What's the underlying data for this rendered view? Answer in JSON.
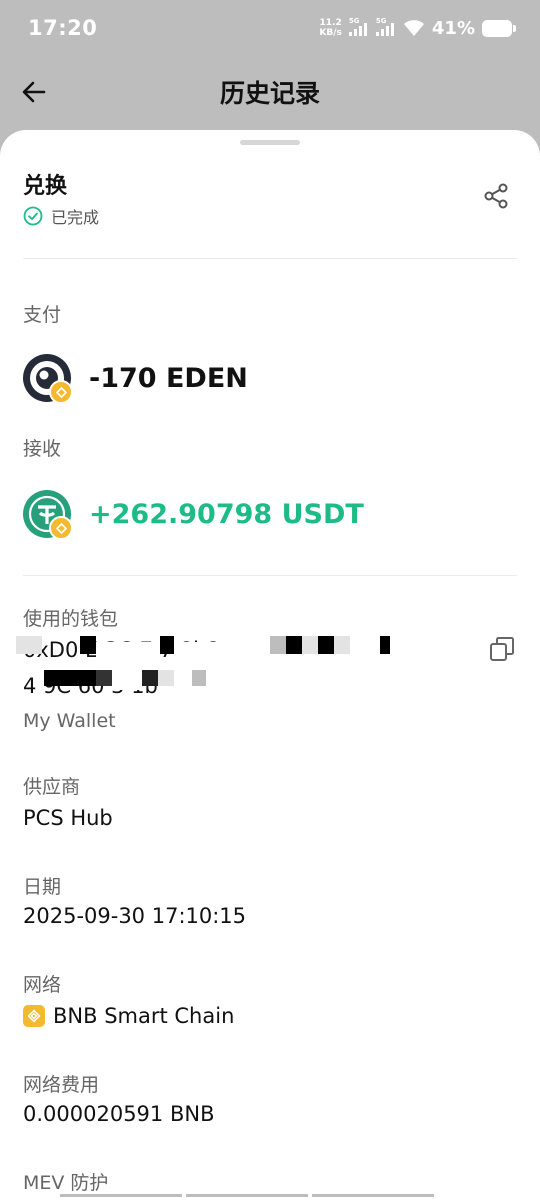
{
  "status_bar": {
    "time": "17:20",
    "net_speed_value": "11.2",
    "net_speed_unit": "KB/s",
    "sim1": "5G",
    "sim2": "5G",
    "battery": "41%"
  },
  "header": {
    "title": "历史记录"
  },
  "tx": {
    "type": "兑换",
    "status": "已完成",
    "pay_label": "支付",
    "pay_amount": "-170 EDEN",
    "receive_label": "接收",
    "receive_amount": "+262.90798 USDT",
    "wallet_label": "使用的钱包",
    "wallet_address_line1": "0xD0  E   3C   7  7   8b8",
    "wallet_address_line2": "4  9C  60  3  1b",
    "wallet_name": "My Wallet",
    "provider_label": "供应商",
    "provider_value": "PCS Hub",
    "date_label": "日期",
    "date_value": "2025-09-30 17:10:15",
    "network_label": "网络",
    "network_value": "BNB Smart Chain",
    "fee_label": "网络费用",
    "fee_value": "0.000020591 BNB",
    "mev_label": "MEV 防护"
  },
  "colors": {
    "positive": "#1dbc86",
    "bnb": "#f3ba2f",
    "usdt": "#26a17b"
  }
}
